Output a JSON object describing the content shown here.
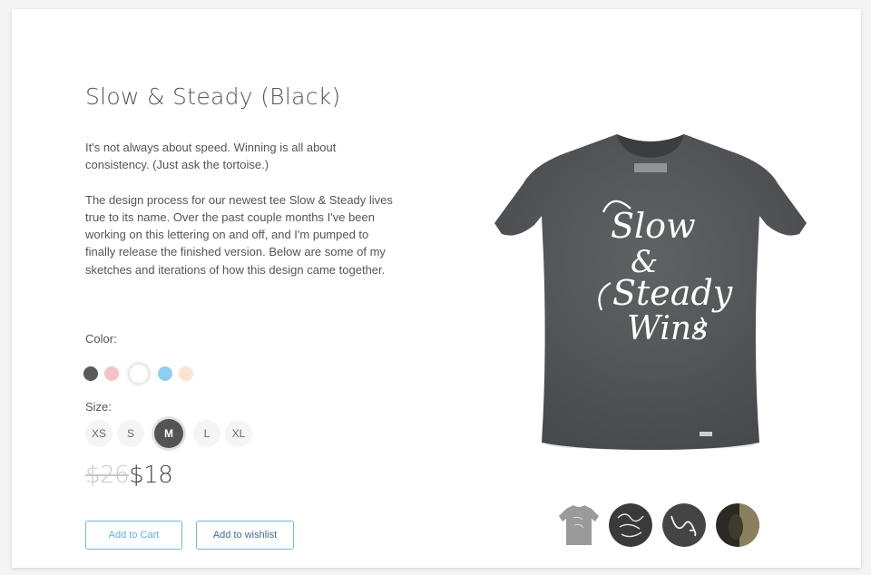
{
  "product": {
    "title": "Slow & Steady (Black)",
    "description": [
      "It's not always about speed. Winning is all about consistency. (Just ask the tortoise.)",
      "The design process for our newest tee Slow & Steady lives true to its name. Over the past couple months I've been working on this lettering on and off, and I'm pumped to finally release the finished version. Below are some of my sketches and iterations of how this design came together."
    ],
    "shirt_print": [
      "Slow",
      "&",
      "Steady",
      "Wins"
    ]
  },
  "color": {
    "label": "Color:",
    "swatches": [
      {
        "name": "dark-gray",
        "hex": "#595959"
      },
      {
        "name": "pink",
        "hex": "#f3c4c4"
      },
      {
        "name": "white",
        "hex": "#ffffff",
        "selected": true
      },
      {
        "name": "blue",
        "hex": "#8ecdf4"
      },
      {
        "name": "peach",
        "hex": "#fde4cf"
      }
    ]
  },
  "size": {
    "label": "Size:",
    "options": [
      "XS",
      "S",
      "M",
      "L",
      "XL"
    ],
    "selected": "M"
  },
  "price": {
    "old": "$26",
    "new": "$18"
  },
  "buttons": {
    "add_to_cart": "Add to Cart",
    "add_to_wishlist": "Add to wishlist"
  },
  "thumbnails": [
    "gray-tee",
    "lettering-sketch-1",
    "lettering-sketch-2",
    "photo"
  ],
  "colors": {
    "accent": "#6fb9e6",
    "shirt": "#545659",
    "text": "#555555"
  }
}
